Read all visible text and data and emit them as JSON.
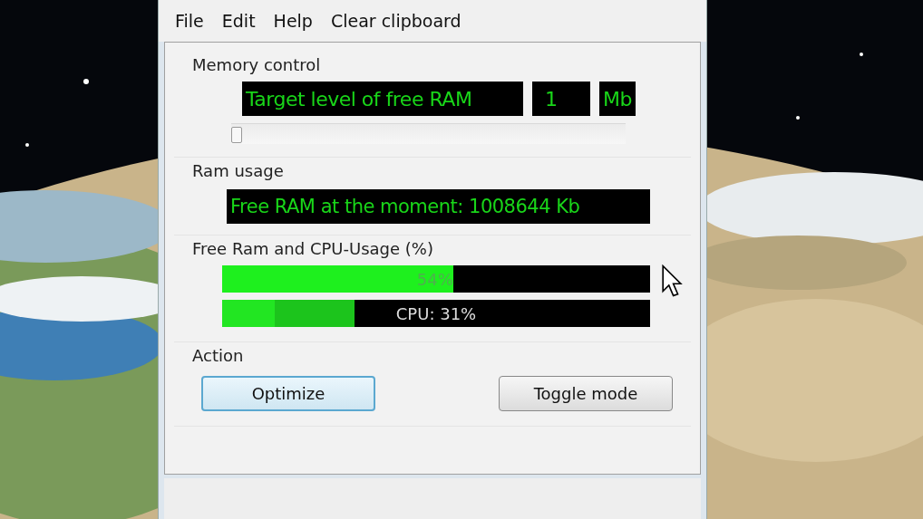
{
  "menu": [
    "File",
    "Edit",
    "Help",
    "Clear clipboard"
  ],
  "memory_control": {
    "title": "Memory control",
    "target_label": "Target level of free RAM",
    "target_value": "1",
    "target_unit": "Mb",
    "slider": {
      "level": 0
    }
  },
  "ram_usage": {
    "title": "Ram usage",
    "display": "Free RAM at the moment: 1008644 Kb"
  },
  "usage": {
    "title": "Free Ram and CPU-Usage (%)",
    "bars": [
      {
        "kind": "ram",
        "level": 0.54,
        "label": "54%"
      },
      {
        "kind": "cpu",
        "level": 0.31,
        "label": "CPU: 31%"
      }
    ]
  },
  "action": {
    "title": "Action",
    "buttons": [
      {
        "label": "Optimize",
        "focused": true
      },
      {
        "label": "Toggle mode",
        "focused": false
      }
    ]
  }
}
